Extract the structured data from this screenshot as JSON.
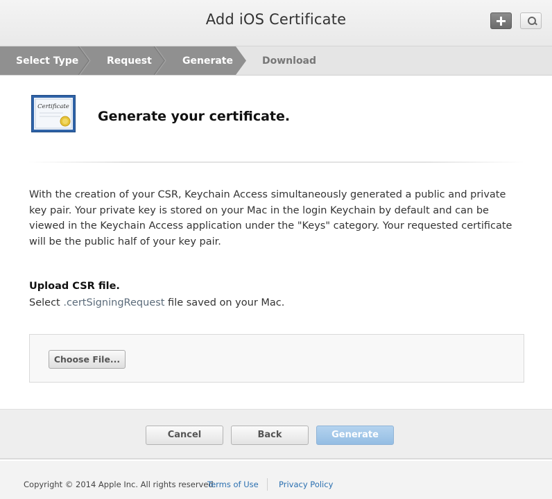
{
  "header": {
    "title": "Add iOS Certificate",
    "add_icon": "plus-icon",
    "search_icon": "search-icon"
  },
  "steps": [
    {
      "label": "Select Type",
      "state": "done"
    },
    {
      "label": "Request",
      "state": "done"
    },
    {
      "label": "Generate",
      "state": "current"
    },
    {
      "label": "Download",
      "state": "upcoming"
    }
  ],
  "colors": {
    "step_active": "#909090",
    "step_inactive": "#e5e5e5",
    "primary_button": "#9dc3e6",
    "link": "#2a6fb0"
  },
  "main": {
    "certificate_icon_text": "Certificate",
    "heading": "Generate your certificate.",
    "body": "With the creation of your CSR, Keychain Access simultaneously generated a public and private key pair. Your private key is stored on your Mac in the login Keychain by default and can be viewed in the Keychain Access application under the \"Keys\" category. Your requested certificate will be the public half of your key pair.",
    "upload_title": "Upload CSR file.",
    "upload_desc_prefix": "Select ",
    "upload_desc_ext": ".certSigningRequest",
    "upload_desc_suffix": " file saved on your Mac.",
    "choose_file_label": "Choose File..."
  },
  "actions": {
    "cancel_label": "Cancel",
    "back_label": "Back",
    "generate_label": "Generate"
  },
  "footer": {
    "copyright": "Copyright © 2014 Apple Inc. All rights reserved.",
    "terms_label": "Terms of Use",
    "privacy_label": "Privacy Policy"
  }
}
